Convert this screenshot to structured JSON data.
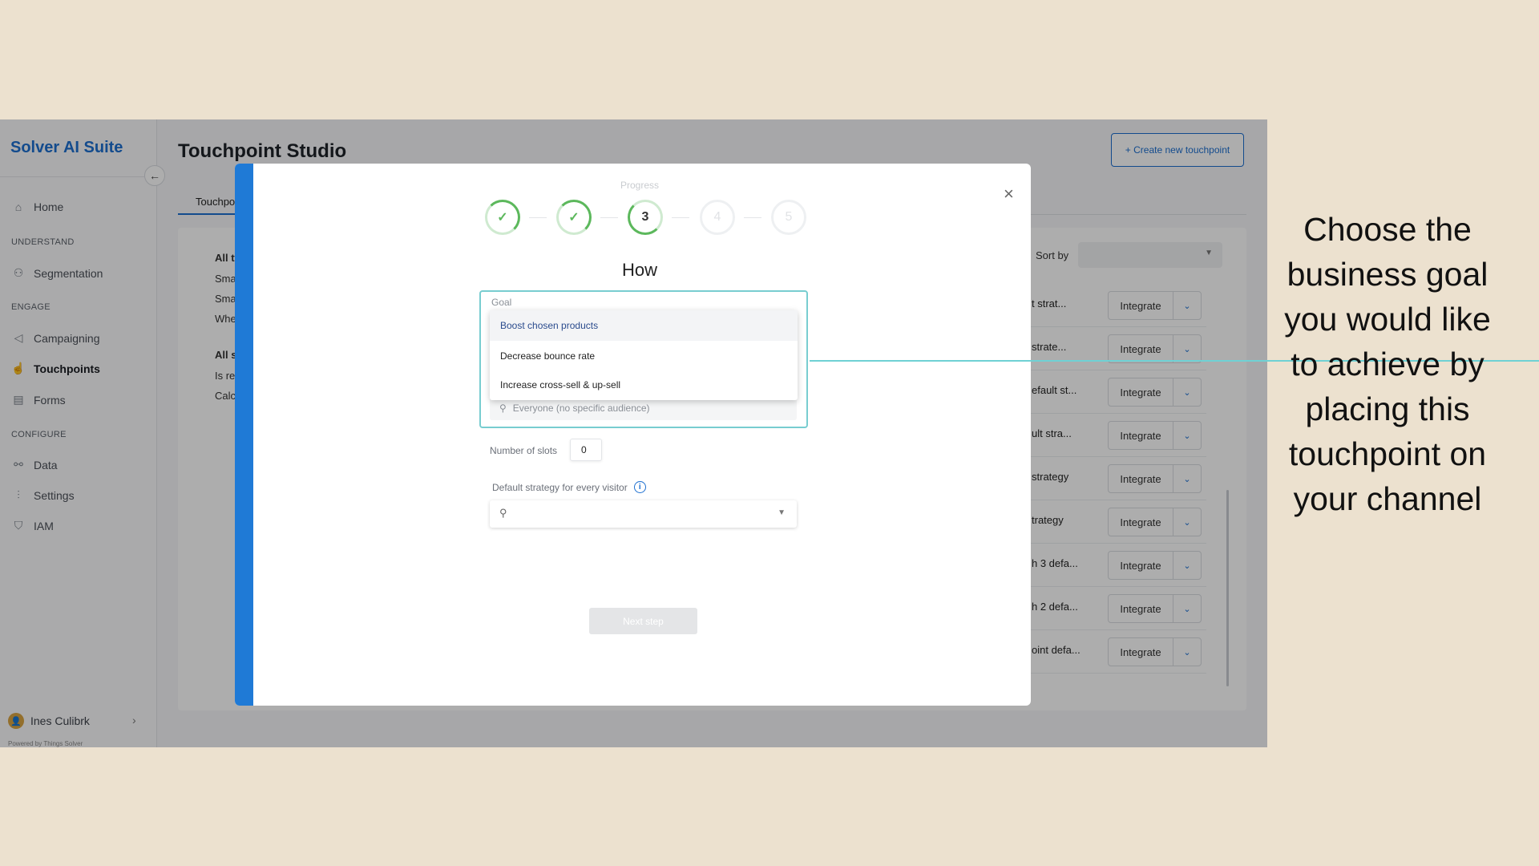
{
  "app": {
    "brand": "Solver AI Suite",
    "title": "Touchpoint Studio",
    "create_button": "+ Create new touchpoint",
    "tab_partial": "Touchpo",
    "sort_by": "Sort by"
  },
  "sidebar": {
    "home": "Home",
    "section_understand": "UNDERSTAND",
    "segmentation": "Segmentation",
    "section_engage": "ENGAGE",
    "campaigning": "Campaigning",
    "touchpoints": "Touchpoints",
    "forms": "Forms",
    "section_configure": "CONFIGURE",
    "data": "Data",
    "settings": "Settings",
    "iam": "IAM",
    "user": "Ines Culibrk",
    "powered": "Powered by Things Solver"
  },
  "filters": {
    "g1_title": "All ty",
    "g1_items": [
      "Sma",
      "Sma",
      "Whe"
    ],
    "g2_title": "All st",
    "g2_items": [
      "Is rea",
      "Calc"
    ]
  },
  "rows": [
    {
      "name": "t strat...",
      "action": "Integrate"
    },
    {
      "name": "strate...",
      "action": "Integrate"
    },
    {
      "name": "efault st...",
      "action": "Integrate"
    },
    {
      "name": "ult stra...",
      "action": "Integrate"
    },
    {
      "name": "strategy",
      "action": "Integrate"
    },
    {
      "name": "trategy",
      "action": "Integrate"
    },
    {
      "name": "h 3 defa...",
      "action": "Integrate"
    },
    {
      "name": "h 2 defa...",
      "action": "Integrate"
    },
    {
      "name": "oint defa...",
      "action": "Integrate"
    }
  ],
  "modal": {
    "progress_label": "Progress",
    "steps": [
      "✓",
      "✓",
      "3",
      "4",
      "5"
    ],
    "heading": "How",
    "goal_label": "Goal",
    "goal_options": [
      "Boost chosen products",
      "Decrease bounce rate",
      "Increase cross-sell & up-sell"
    ],
    "audience_placeholder": "Everyone (no specific audience)",
    "slots_label": "Number of slots",
    "slots_value": "0",
    "default_strategy_label": "Default strategy for every visitor",
    "next_button": "Next step"
  },
  "annotation": "Choose the business goal you would like to achieve by placing this touchpoint on your channel",
  "colors": {
    "accent": "#1c6fd0",
    "background": "#ece1cf",
    "highlight": "#78cdd0",
    "success": "#5cb85c"
  }
}
